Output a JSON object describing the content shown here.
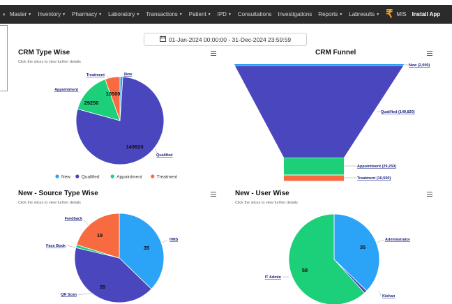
{
  "navbar": {
    "items": [
      {
        "label": "Master"
      },
      {
        "label": "Inventory"
      },
      {
        "label": "Pharmacy"
      },
      {
        "label": "Laboratory"
      },
      {
        "label": "Transactions"
      },
      {
        "label": "Patient"
      },
      {
        "label": "IPD"
      },
      {
        "label": "Consultations"
      },
      {
        "label": "Investigations"
      },
      {
        "label": "Reports"
      },
      {
        "label": "Labresults"
      }
    ],
    "mis_label": "MIS",
    "install_label": "Install App"
  },
  "date_range": "01-Jan-2024 00:00:00 - 31-Dec-2024 23:59:59",
  "cards": {
    "crm_type": {
      "title": "CRM Type Wise",
      "subtitle": "Click the slices to view further details"
    },
    "crm_funnel": {
      "title": "CRM Funnel"
    },
    "source_type": {
      "title": "New - Source Type Wise",
      "subtitle": "Click the slices to view further details"
    },
    "user_wise": {
      "title": "New - User Wise",
      "subtitle": "Click the slices to view further details"
    }
  },
  "legend": [
    {
      "name": "New",
      "color": "#2ba3f7"
    },
    {
      "name": "Qualified",
      "color": "#4a46bd"
    },
    {
      "name": "Appointment",
      "color": "#1cd07a"
    },
    {
      "name": "Treatment",
      "color": "#f86a3f"
    }
  ],
  "chart_data": [
    {
      "type": "pie",
      "title": "CRM Type Wise",
      "categories": [
        "New",
        "Qualified",
        "Appointment",
        "Treatment"
      ],
      "values": [
        2000,
        149820,
        29250,
        10500
      ],
      "data_labels": [
        "",
        "149820",
        "29250",
        "10500"
      ],
      "callouts": [
        "New",
        "Qualified",
        "Appointment",
        "Treatment"
      ],
      "colors": [
        "#2ba3f7",
        "#4a46bd",
        "#1cd07a",
        "#f86a3f"
      ],
      "legend": "bottom"
    },
    {
      "type": "funnel",
      "title": "CRM Funnel",
      "categories": [
        "New",
        "Qualified",
        "Appointment",
        "Treatment"
      ],
      "values": [
        2000,
        149820,
        29250,
        10500
      ],
      "labels": [
        "New (2,000)",
        "Qualified (149,820)",
        "Appointment (29,250)",
        "Treatment (10,500)"
      ],
      "colors": [
        "#2ba3f7",
        "#4a46bd",
        "#1cd07a",
        "#f86a3f"
      ]
    },
    {
      "type": "pie",
      "title": "New - Source Type Wise",
      "categories": [
        "HMS",
        "QR Scan",
        "Face Book",
        "Feedback"
      ],
      "values": [
        35,
        39,
        1,
        19
      ],
      "data_labels": [
        "35",
        "39",
        "",
        "19"
      ],
      "callouts": [
        "HMS",
        "QR Scan",
        "Face Book",
        "Feedback"
      ],
      "colors": [
        "#2ba3f7",
        "#4a46bd",
        "#1cd07a",
        "#f86a3f"
      ]
    },
    {
      "type": "pie",
      "title": "New - User Wise",
      "categories": [
        "Administrator",
        "Kishan",
        "IT Admin"
      ],
      "values": [
        35,
        1,
        58
      ],
      "data_labels": [
        "35",
        "",
        "58"
      ],
      "callouts": [
        "Administrator",
        "Kishan",
        "IT Admin"
      ],
      "colors": [
        "#2ba3f7",
        "#4a46bd",
        "#1cd07a"
      ]
    }
  ]
}
